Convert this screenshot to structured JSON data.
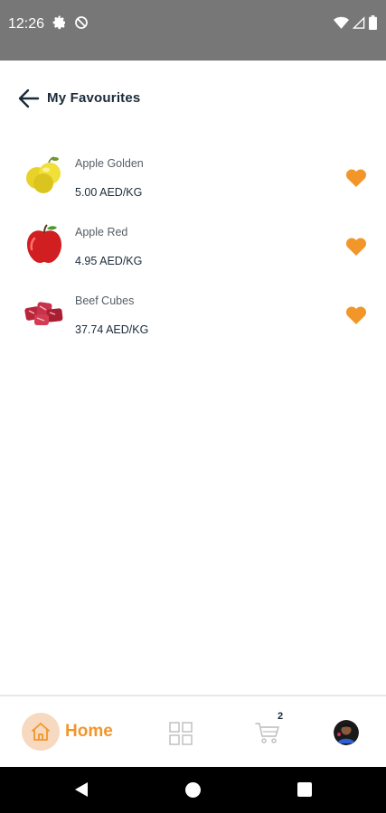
{
  "status_bar": {
    "time": "12:26",
    "icons": [
      "settings-icon",
      "do-not-disturb-icon",
      "wifi-icon",
      "cell-signal-icon",
      "battery-icon"
    ]
  },
  "header": {
    "title": "My Favourites",
    "back_icon": "arrow-left-icon"
  },
  "favourites": [
    {
      "name": "Apple Golden",
      "price": "5.00 AED/KG",
      "image": "golden-apple-image",
      "favourite": true
    },
    {
      "name": "Apple Red",
      "price": "4.95 AED/KG",
      "image": "red-apple-image",
      "favourite": true
    },
    {
      "name": "Beef Cubes",
      "price": "37.74 AED/KG",
      "image": "beef-cubes-image",
      "favourite": true
    }
  ],
  "bottom_nav": {
    "home_label": "Home",
    "cart_count": "2",
    "icons": [
      "home-icon",
      "grid-icon",
      "cart-icon",
      "profile-avatar"
    ]
  },
  "colors": {
    "accent": "#F2962A",
    "accent_light": "#F7D9BF",
    "text_dark": "#1B2A3A",
    "status_bar": "#777777"
  }
}
